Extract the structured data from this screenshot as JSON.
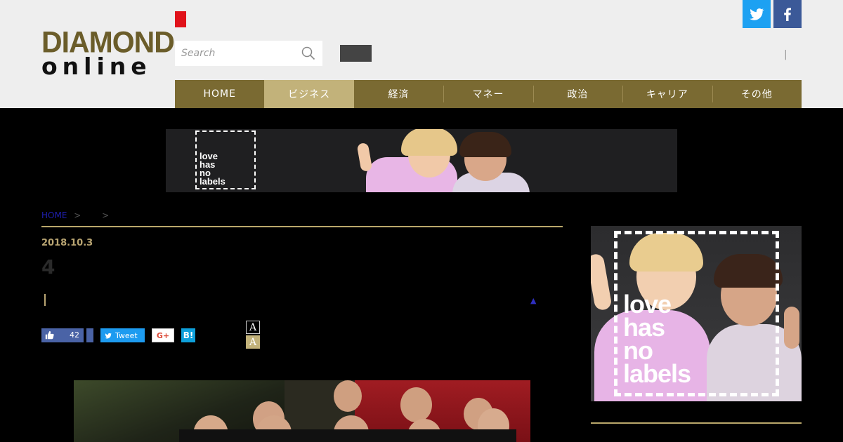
{
  "logo": {
    "line1": "DIAMOND",
    "line2": "online"
  },
  "search": {
    "placeholder": "Search"
  },
  "header": {
    "separator": "|"
  },
  "social": {
    "twitter_icon": "twitter-icon",
    "facebook_icon": "facebook-icon"
  },
  "nav": {
    "items": [
      {
        "label": "HOME"
      },
      {
        "label": "ビジネス"
      },
      {
        "label": "経済"
      },
      {
        "label": "マネー"
      },
      {
        "label": "政治"
      },
      {
        "label": "キャリア"
      },
      {
        "label": "その他"
      }
    ],
    "active_index": 1
  },
  "banner": {
    "text_line1": "love",
    "text_line2": "has",
    "text_line3": "no",
    "text_line4": "labels"
  },
  "breadcrumb": {
    "home": "HOME",
    "sep1": ">",
    "sep2": ">"
  },
  "article": {
    "date": "2018.10.3",
    "headline": "4",
    "up_arrow": "▲"
  },
  "share": {
    "like_count": "42",
    "tweet_label": "Tweet",
    "gplus_label": "G+",
    "hatena_label": "B!"
  },
  "font_size": {
    "small": "A",
    "large": "A"
  },
  "side_ad": {
    "text_line1": "love",
    "text_line2": "has",
    "text_line3": "no",
    "text_line4": "labels"
  },
  "colors": {
    "gold": "#7a6a32",
    "gold_light": "#c2b27a",
    "header_bg": "#eeeeee",
    "page_bg": "#000000"
  }
}
